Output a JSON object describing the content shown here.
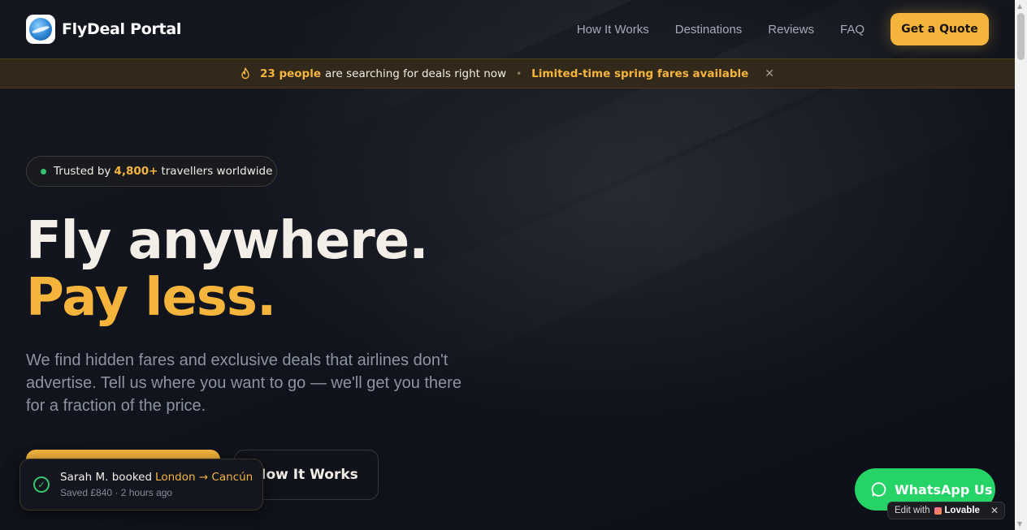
{
  "header": {
    "brand": "FlyDeal Portal",
    "nav": [
      "How It Works",
      "Destinations",
      "Reviews",
      "FAQ"
    ],
    "cta": "Get a Quote"
  },
  "announcement": {
    "count": "23 people",
    "text": "are searching for deals right now",
    "separator": "•",
    "promo": "Limited-time spring fares available",
    "close": "✕"
  },
  "hero": {
    "trust_prefix": "Trusted by",
    "trust_count": "4,800+",
    "trust_suffix": "travellers worldwide",
    "headline_1": "Fly anywhere.",
    "headline_2": "Pay less.",
    "subtitle": "We find hidden fares and exclusive deals that airlines don't advertise. Tell us where you want to go — we'll get you there for a fraction of the price.",
    "secondary_cta": "How It Works"
  },
  "toast": {
    "name": "Sarah M. booked",
    "route": "London → Cancún",
    "detail": "Saved £840 · 2 hours ago"
  },
  "whatsapp": {
    "label": "WhatsApp Us"
  },
  "lovable": {
    "prefix": "Edit with",
    "name": "Lovable",
    "close": "✕"
  },
  "colors": {
    "accent": "#f5b53c",
    "background": "#0f121b",
    "success": "#35c46d",
    "whatsapp": "#25d366"
  },
  "icons": [
    "flame-icon",
    "close-icon",
    "check-circle-icon",
    "whatsapp-chat-icon",
    "lovable-heart-icon"
  ]
}
